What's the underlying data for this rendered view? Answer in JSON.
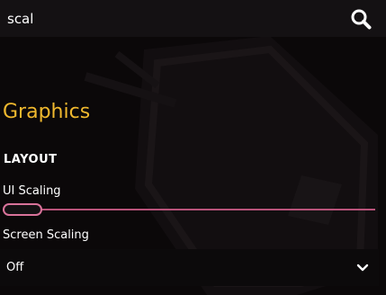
{
  "search": {
    "value": "scal",
    "icon": "search-icon"
  },
  "section": {
    "title": "Graphics"
  },
  "layout": {
    "heading": "LAYOUT",
    "ui_scaling": {
      "label": "UI Scaling",
      "level": 0.0
    },
    "screen_scaling": {
      "label": "Screen Scaling",
      "selected": "Off",
      "icon": "chevron-down-icon"
    }
  },
  "colors": {
    "accent_title": "#f0b82e",
    "slider_accent": "#d9739a",
    "background": "#0b0809"
  }
}
